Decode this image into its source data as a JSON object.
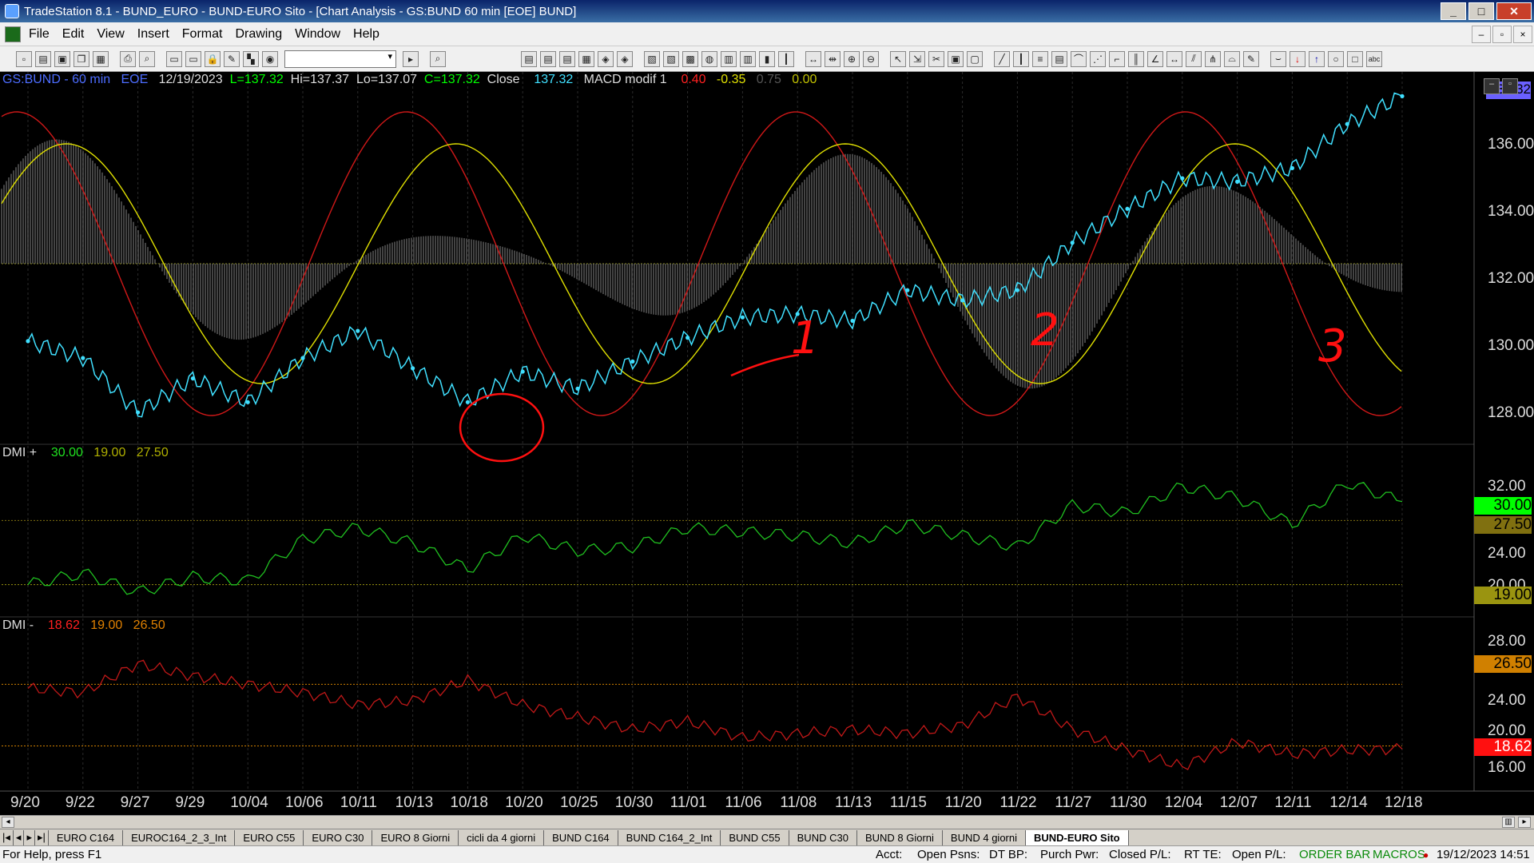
{
  "window": {
    "title": "TradeStation 8.1 - BUND_EURO - BUND-EURO Sito - [Chart Analysis - GS:BUND  60 min  [EOE] BUND]"
  },
  "menu": [
    "File",
    "Edit",
    "View",
    "Insert",
    "Format",
    "Drawing",
    "Window",
    "Help"
  ],
  "header": {
    "symbol": "GS:BUND - 60 min",
    "exch": "EOE",
    "date": "12/19/2023",
    "last": "L=137.32",
    "hi": "Hi=137.37",
    "lo": "Lo=137.07",
    "close": "C=137.32",
    "close_label": "Close",
    "close_value": "137.32",
    "macd_label": "MACD modif 1",
    "macd_v1": "0.40",
    "macd_v2": "-0.35",
    "macd_v3": "0.75",
    "macd_v4": "0.00"
  },
  "dmi_plus": {
    "label": "DMI +",
    "v1": "30.00",
    "v2": "19.00",
    "v3": "27.50"
  },
  "dmi_minus": {
    "label": "DMI -",
    "v1": "18.62",
    "v2": "19.00",
    "v3": "26.50"
  },
  "price_axis": [
    "136.00",
    "134.00",
    "132.00",
    "130.00",
    "128.00"
  ],
  "price_last_label": "137.32",
  "dmip_axis": [
    "32.00",
    "24.00",
    "20.00"
  ],
  "dmip_badges": {
    "current": "30.00",
    "upper": "27.50",
    "lower": "19.00"
  },
  "dmim_axis": [
    "28.00",
    "24.00",
    "20.00",
    "16.00"
  ],
  "dmim_badges": {
    "upper": "26.50",
    "current": "18.62"
  },
  "dates": [
    "9/20",
    "9/22",
    "9/27",
    "9/29",
    "10/04",
    "10/06",
    "10/11",
    "10/13",
    "10/18",
    "10/20",
    "10/25",
    "10/30",
    "11/01",
    "11/06",
    "11/08",
    "11/13",
    "11/15",
    "11/20",
    "11/22",
    "11/27",
    "11/30",
    "12/04",
    "12/07",
    "12/11",
    "12/14",
    "12/18"
  ],
  "annotations": [
    "1",
    "2",
    "3"
  ],
  "tabs": [
    "EURO C164",
    "EUROC164_2_3_Int",
    "EURO C55",
    "EURO C30",
    "EURO 8 Giorni",
    "cicli da 4 giorni",
    "BUND C164",
    "BUND C164_2_Int",
    "BUND C55",
    "BUND  C30",
    "BUND 8 Giorni",
    "BUND 4 giorni",
    "BUND-EURO Sito"
  ],
  "status": {
    "help": "For Help, press F1",
    "acct": "Acct:",
    "open_psns": "Open Psns:",
    "dt_bp": "DT BP:",
    "purch_pwr": "Purch Pwr:",
    "closed_pl": "Closed P/L:",
    "rt_te": "RT TE:",
    "open_pl": "Open P/L:",
    "order_bar": "ORDER BAR",
    "macros": "MACROS",
    "datetime": "19/12/2023 14:51"
  },
  "colors": {
    "price": "#40e0ff",
    "macd": "#d01818",
    "signal": "#e0e000",
    "hist": "#808080",
    "dmi_plus": "#20c020",
    "dmi_minus": "#c01818",
    "header_symbol": "#4c6cff"
  },
  "chart_data": [
    {
      "type": "line",
      "series": [
        {
          "values_x_dates": [
            "9/20",
            "9/22",
            "9/27",
            "9/29",
            "10/04",
            "10/06",
            "10/11",
            "10/13",
            "10/18",
            "10/20",
            "10/25",
            "10/30",
            "11/01",
            "11/06",
            "11/08",
            "11/13",
            "11/15",
            "11/20",
            "11/22",
            "11/27",
            "11/30",
            "12/04",
            "12/07",
            "12/11",
            "12/14",
            "12/18"
          ],
          "values": [
            130.1,
            129.6,
            128.0,
            129.0,
            128.3,
            129.6,
            130.4,
            129.3,
            128.3,
            129.2,
            128.7,
            129.5,
            130.2,
            130.8,
            130.9,
            130.7,
            131.6,
            131.3,
            131.6,
            133.0,
            134.0,
            134.9,
            134.8,
            135.2,
            136.5,
            137.32
          ]
        }
      ],
      "ylim": [
        127.2,
        137.8
      ]
    },
    {
      "type": "line",
      "series": [
        {
          "name": "DMI +",
          "values": [
            19.0,
            20.5,
            18.0,
            20.0,
            19.5,
            25.0,
            26.5,
            24.5,
            21.0,
            25.5,
            23.5,
            24.0,
            26.5,
            26.0,
            25.5,
            24.5,
            27.0,
            25.5,
            24.0,
            29.5,
            28.5,
            32.0,
            30.5,
            27.0,
            32.5,
            30.0
          ]
        }
      ],
      "ylim": [
        16,
        34
      ]
    },
    {
      "type": "line",
      "series": [
        {
          "name": "DMI -",
          "values": [
            26.0,
            25.5,
            29.0,
            27.5,
            26.5,
            25.5,
            24.0,
            24.5,
            27.0,
            24.0,
            22.5,
            21.0,
            22.0,
            20.0,
            20.5,
            21.0,
            20.5,
            21.5,
            25.0,
            21.0,
            18.5,
            16.5,
            19.5,
            18.0,
            18.5,
            18.62
          ]
        }
      ],
      "ylim": [
        14,
        31
      ]
    }
  ]
}
